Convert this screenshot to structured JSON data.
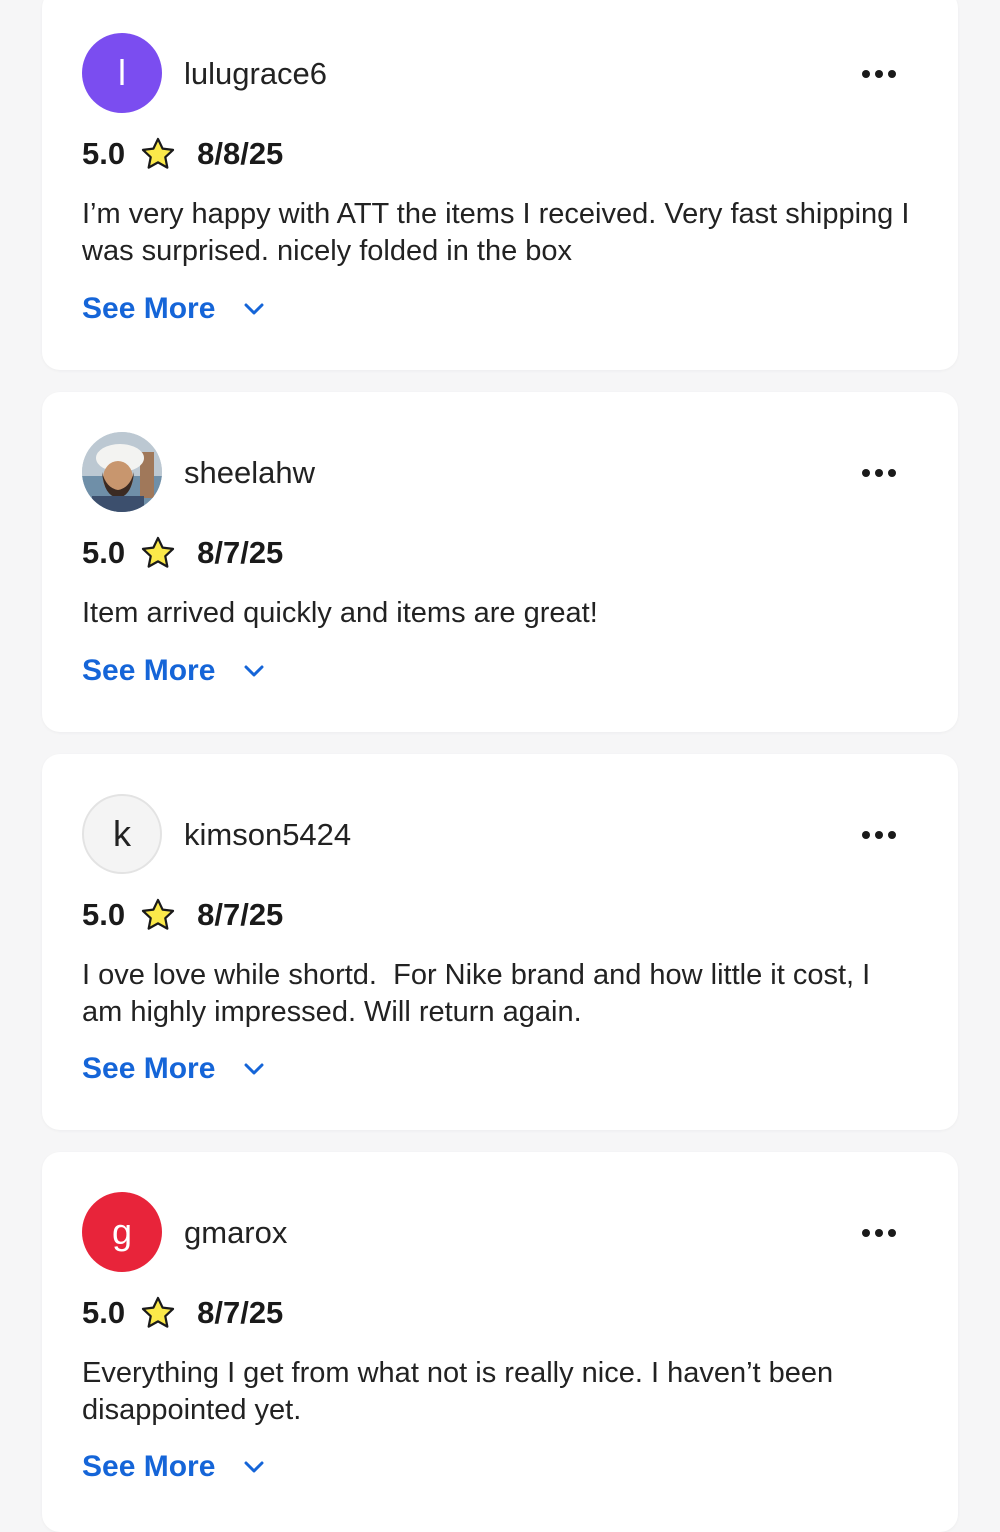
{
  "reviews": [
    {
      "username": "lulugrace6",
      "avatar_letter": "l",
      "avatar_color": "#7b4df0",
      "rating": "5.0",
      "date": "8/8/25",
      "text": "I’m very happy with ATT the items I received. Very fast shipping I was surprised. nicely folded in the box",
      "see_more": "See More"
    },
    {
      "username": "sheelahw",
      "avatar_letter": "",
      "avatar_color": "photo",
      "rating": "5.0",
      "date": "8/7/25",
      "text": "Item arrived quickly and items are great!",
      "see_more": "See More"
    },
    {
      "username": "kimson5424",
      "avatar_letter": "k",
      "avatar_color": "#f4f4f4",
      "rating": "5.0",
      "date": "8/7/25",
      "text": "I ove love while shortd.  For Nike brand and how little it cost, I am highly impressed. Will return again.",
      "see_more": "See More"
    },
    {
      "username": "gmarox",
      "avatar_letter": "g",
      "avatar_color": "#e8243a",
      "rating": "5.0",
      "date": "8/7/25",
      "text": "Everything I get from what not is really nice. I haven’t been disappointed yet.",
      "see_more": "See More"
    }
  ],
  "colors": {
    "link": "#1565d8",
    "star_fill": "#fbe94a",
    "star_stroke": "#1a1a1a"
  }
}
